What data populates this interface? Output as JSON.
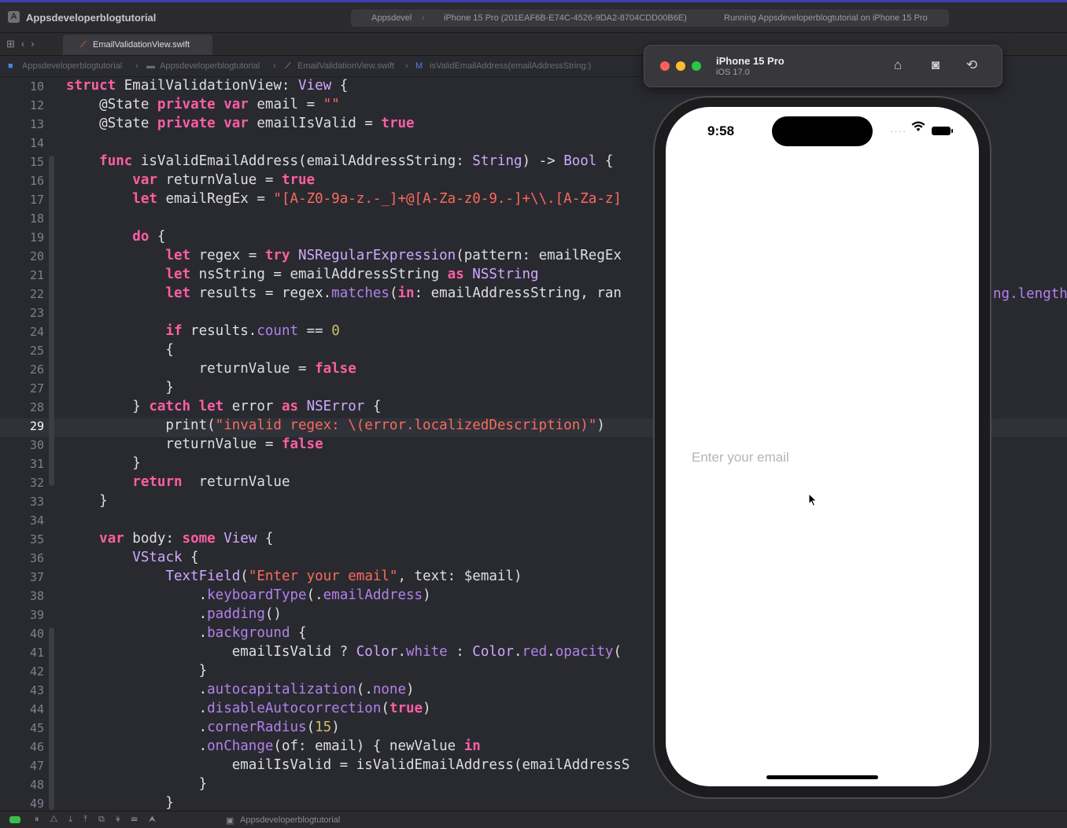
{
  "window": {
    "app_title": "Appsdeveloperblogtutorial",
    "scheme": "Appsdevel",
    "device_target": "iPhone 15 Pro (201EAF6B-E74C-4526-9DA2-8704CDD00B6E)",
    "status": "Running Appsdeveloperblogtutorial on iPhone 15 Pro"
  },
  "tab": {
    "label": "EmailValidationView.swift"
  },
  "breadcrumbs": [
    "Appsdeveloperblogtutorial",
    "Appsdeveloperblogtutorial",
    "EmailValidationView.swift",
    "isValidEmailAddress(emailAddressString:)"
  ],
  "editor": {
    "current_line": 29,
    "lines": [
      {
        "n": "10",
        "t": "struct EmailValidationView: View {"
      },
      {
        "n": "12",
        "t": "    @State private var email = \"\""
      },
      {
        "n": "13",
        "t": "    @State private var emailIsValid = true"
      },
      {
        "n": "14",
        "t": ""
      },
      {
        "n": "15",
        "t": "    func isValidEmailAddress(emailAddressString: String) -> Bool {"
      },
      {
        "n": "16",
        "t": "        var returnValue = true"
      },
      {
        "n": "17",
        "t": "        let emailRegEx = \"[A-Z0-9a-z.-_]+@[A-Za-z0-9.-]+\\\\.[A-Za-z]"
      },
      {
        "n": "18",
        "t": ""
      },
      {
        "n": "19",
        "t": "        do {"
      },
      {
        "n": "20",
        "t": "            let regex = try NSRegularExpression(pattern: emailRegEx"
      },
      {
        "n": "21",
        "t": "            let nsString = emailAddressString as NSString"
      },
      {
        "n": "22",
        "t": "            let results = regex.matches(in: emailAddressString, ran"
      },
      {
        "n": "23",
        "t": ""
      },
      {
        "n": "24",
        "t": "            if results.count == 0"
      },
      {
        "n": "25",
        "t": "            {"
      },
      {
        "n": "26",
        "t": "                returnValue = false"
      },
      {
        "n": "27",
        "t": "            }"
      },
      {
        "n": "28",
        "t": "        } catch let error as NSError {"
      },
      {
        "n": "29",
        "t": "            print(\"invalid regex: \\(error.localizedDescription)\")"
      },
      {
        "n": "30",
        "t": "            returnValue = false"
      },
      {
        "n": "31",
        "t": "        }"
      },
      {
        "n": "32",
        "t": "        return  returnValue"
      },
      {
        "n": "33",
        "t": "    }"
      },
      {
        "n": "34",
        "t": ""
      },
      {
        "n": "35",
        "t": "    var body: some View {"
      },
      {
        "n": "36",
        "t": "        VStack {"
      },
      {
        "n": "37",
        "t": "            TextField(\"Enter your email\", text: $email)"
      },
      {
        "n": "38",
        "t": "                .keyboardType(.emailAddress)"
      },
      {
        "n": "39",
        "t": "                .padding()"
      },
      {
        "n": "40",
        "t": "                .background {"
      },
      {
        "n": "41",
        "t": "                    emailIsValid ? Color.white : Color.red.opacity("
      },
      {
        "n": "42",
        "t": "                }"
      },
      {
        "n": "43",
        "t": "                .autocapitalization(.none)"
      },
      {
        "n": "44",
        "t": "                .disableAutocorrection(true)"
      },
      {
        "n": "45",
        "t": "                .cornerRadius(15)"
      },
      {
        "n": "46",
        "t": "                .onChange(of: email) { newValue in"
      },
      {
        "n": "47",
        "t": "                    emailIsValid = isValidEmailAddress(emailAddressS"
      },
      {
        "n": "48",
        "t": "                }"
      },
      {
        "n": "49",
        "t": "            }"
      }
    ],
    "overflow_fragment": "ng.length"
  },
  "simulator": {
    "device_name": "iPhone 15 Pro",
    "os_version": "iOS 17.0",
    "time": "9:58",
    "email_placeholder": "Enter your email",
    "email_value": ""
  },
  "bottom_bar": {
    "label": "Appsdeveloperblogtutorial"
  }
}
